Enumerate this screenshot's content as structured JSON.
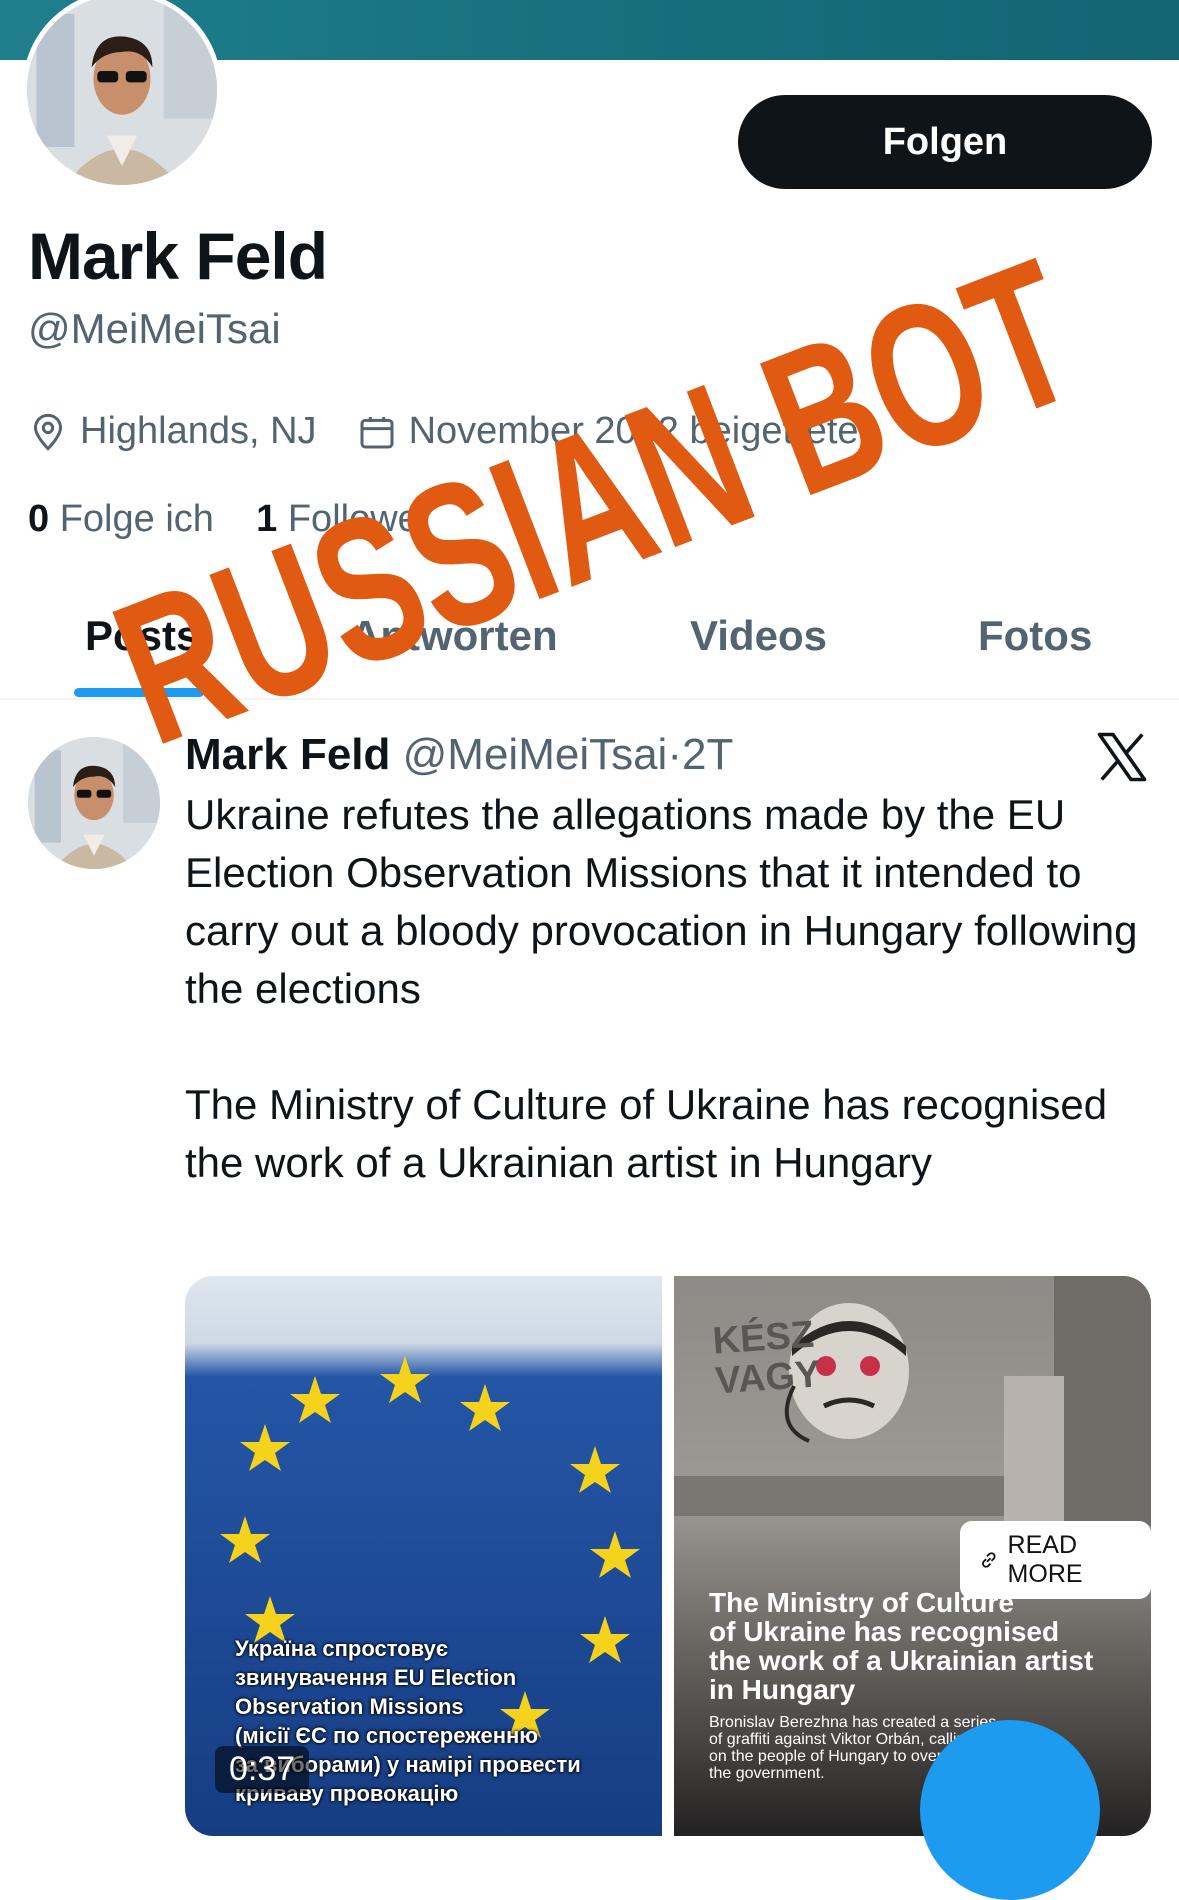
{
  "profile": {
    "name": "Mark Feld",
    "handle": "@MeiMeiTsai",
    "follow_label": "Folgen",
    "location": "Highlands, NJ",
    "joined": "November 2002 beigetreten",
    "following_count": "0",
    "following_label": "Folge ich",
    "followers_count": "1",
    "followers_label": "Follower"
  },
  "tabs": [
    "Posts",
    "Antworten",
    "Videos",
    "Fotos"
  ],
  "post": {
    "name": "Mark Feld",
    "handle": "@MeiMeiTsai",
    "separator": "·",
    "time": "2T",
    "text": "Ukraine refutes the allegations made by the EU Election Observation Missions that it intended to carry out a bloody provocation in Hungary following the elections\n\nThe Ministry of Culture of Ukraine has recognised the work of a Ukrainian artist in Hungary",
    "media": {
      "left": {
        "caption": "Україна спростовує\nзвинувачення EU Election\nObservation Missions\n(місії ЄС по спостереженню\nза виборами) у намірі провести\nкриваву провокацію",
        "duration": "0:37"
      },
      "right": {
        "graffiti": "KÉSZ\nVAGY",
        "read_more": "READ MORE",
        "title": "The Ministry of Culture\nof Ukraine has recognised\nthe work of a Ukrainian artist\nin Hungary",
        "subtitle": "Bronislav Berezhna has created a series\nof graffiti against Viktor Orbán, calling\non the people of Hungary to overthrow\nthe government."
      }
    }
  },
  "overlay": {
    "stamp_text": "RUSSIAN BOT",
    "stamp_color": "#e05a12"
  },
  "colors": {
    "banner": "#17707d",
    "accent": "#1d9bf0",
    "text_primary": "#0f1419",
    "text_secondary": "#536471"
  }
}
